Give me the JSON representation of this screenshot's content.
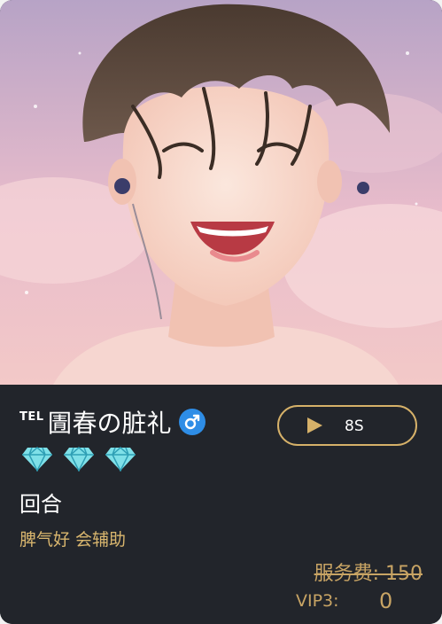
{
  "profile": {
    "tel_badge": "TEL",
    "nickname": "圊春の脏礼",
    "gender_icon": "male-symbol-icon",
    "gender_color": "#2e8de6",
    "diamond_count": 3,
    "diamond_color": "#7fe0e8",
    "round_label": "回合",
    "tags": "脾气好 会辅助"
  },
  "voice": {
    "duration": "8S",
    "accent_color": "#d6b169"
  },
  "pricing": {
    "service_fee": "服务费: 150",
    "vip_label": "VIP3:",
    "vip_price": "0"
  }
}
